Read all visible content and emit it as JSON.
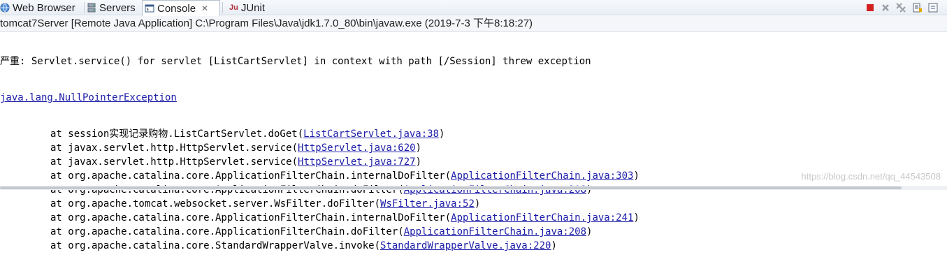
{
  "tabs": [
    {
      "label": "Web Browser",
      "icon": "globe-icon"
    },
    {
      "label": "Servers",
      "icon": "servers-icon"
    },
    {
      "label": "Console",
      "icon": "console-icon",
      "close": "✕",
      "active": true
    },
    {
      "label": "JUnit",
      "icon": "junit-icon",
      "icon_text": "Ju"
    }
  ],
  "toolbar": {
    "buttons": [
      "terminate-icon",
      "remove-launch-icon",
      "remove-all-icon",
      "scroll-lock-icon",
      "pin-console-icon"
    ]
  },
  "console": {
    "title": "tomcat7Server [Remote Java Application] C:\\Program Files\\Java\\jdk1.7.0_80\\bin\\javaw.exe (2019-7-3 下午8:18:27)",
    "error_line": "严重: Servlet.service() for servlet [ListCartServlet] in context with path [/Session] threw exception",
    "exception": "java.lang.NullPointerException",
    "stack": [
      {
        "prefix": "at session实现记录购物.ListCartServlet.doGet(",
        "link": "ListCartServlet.java:38",
        "suffix": ")"
      },
      {
        "prefix": "at javax.servlet.http.HttpServlet.service(",
        "link": "HttpServlet.java:620",
        "suffix": ")"
      },
      {
        "prefix": "at javax.servlet.http.HttpServlet.service(",
        "link": "HttpServlet.java:727",
        "suffix": ")"
      },
      {
        "prefix": "at org.apache.catalina.core.ApplicationFilterChain.internalDoFilter(",
        "link": "ApplicationFilterChain.java:303",
        "suffix": ")"
      },
      {
        "prefix": "at org.apache.catalina.core.ApplicationFilterChain.doFilter(",
        "link": "ApplicationFilterChain.java:208",
        "suffix": ")"
      },
      {
        "prefix": "at org.apache.tomcat.websocket.server.WsFilter.doFilter(",
        "link": "WsFilter.java:52",
        "suffix": ")"
      },
      {
        "prefix": "at org.apache.catalina.core.ApplicationFilterChain.internalDoFilter(",
        "link": "ApplicationFilterChain.java:241",
        "suffix": ")"
      },
      {
        "prefix": "at org.apache.catalina.core.ApplicationFilterChain.doFilter(",
        "link": "ApplicationFilterChain.java:208",
        "suffix": ")"
      },
      {
        "prefix": "at org.apache.catalina.core.StandardWrapperValve.invoke(",
        "link": "StandardWrapperValve.java:220",
        "suffix": ")"
      }
    ]
  },
  "watermark": "https://blog.csdn.net/qq_44543508",
  "colors": {
    "link": "#1c1ca8",
    "terminate": "#d32020",
    "tab_border": "#b5c2d1"
  }
}
